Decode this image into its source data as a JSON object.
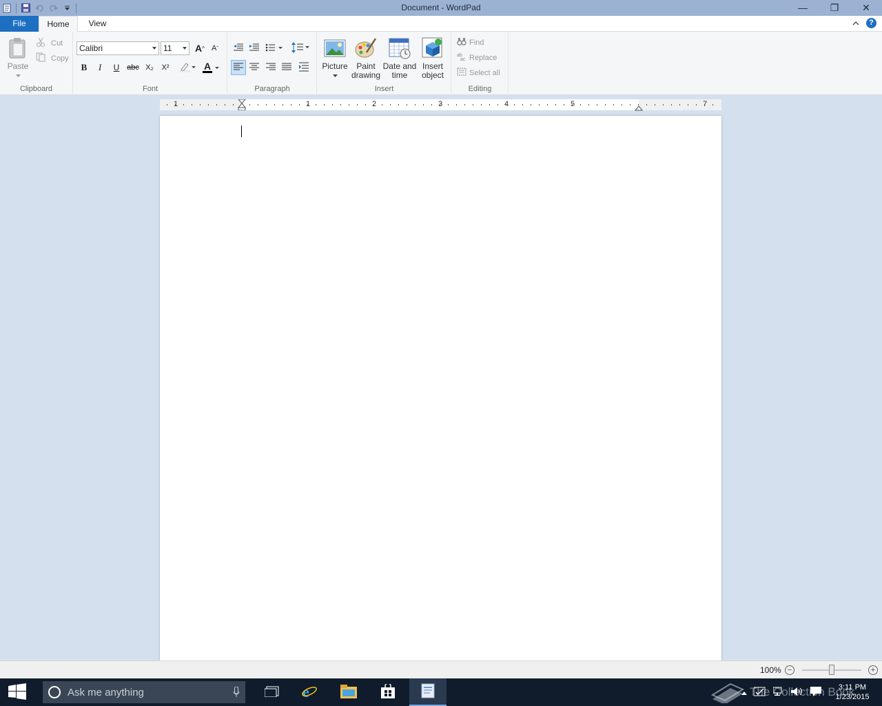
{
  "window": {
    "title": "Document - WordPad",
    "minimize_glyph": "—",
    "restore_glyph": "❐",
    "close_glyph": "✕"
  },
  "tabs": {
    "file": "File",
    "home": "Home",
    "view": "View"
  },
  "clipboard": {
    "group_label": "Clipboard",
    "paste": "Paste",
    "cut": "Cut",
    "copy": "Copy"
  },
  "font": {
    "group_label": "Font",
    "family": "Calibri",
    "size": "11",
    "grow_glyph": "A",
    "shrink_glyph": "A",
    "bold": "B",
    "italic": "I",
    "underline": "U",
    "strike": "abc",
    "subscript": "X₂",
    "superscript": "X²",
    "color_glyph": "A"
  },
  "paragraph": {
    "group_label": "Paragraph"
  },
  "insert": {
    "group_label": "Insert",
    "picture": "Picture",
    "paint_1": "Paint",
    "paint_2": "drawing",
    "date_1": "Date and",
    "date_2": "time",
    "object_1": "Insert",
    "object_2": "object"
  },
  "editing": {
    "group_label": "Editing",
    "find": "Find",
    "replace": "Replace",
    "select_all": "Select all"
  },
  "ruler": {
    "labels": [
      "1",
      "1",
      "2",
      "3",
      "4",
      "5",
      "7"
    ]
  },
  "status": {
    "zoom": "100%",
    "zoom_out": "−",
    "zoom_in": "+"
  },
  "taskbar": {
    "search_placeholder": "Ask me anything",
    "time": "3:11 PM",
    "date": "1/23/2015",
    "watermark": "The Collection Book"
  },
  "colors": {
    "accent": "#1c6fc1",
    "titlebar": "#9bb2d3",
    "taskbar": "#101c2c"
  }
}
